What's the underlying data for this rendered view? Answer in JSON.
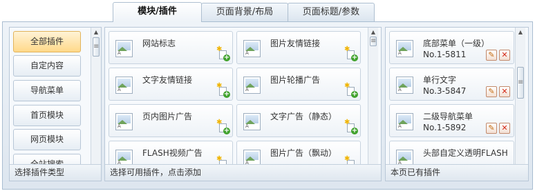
{
  "tabs": [
    {
      "label": "模块/插件",
      "active": true
    },
    {
      "label": "页面背景/布局",
      "active": false
    },
    {
      "label": "页面标题/参数",
      "active": false
    }
  ],
  "left_panel": {
    "categories": [
      {
        "label": "全部插件",
        "active": true
      },
      {
        "label": "自定内容",
        "active": false
      },
      {
        "label": "导航菜单",
        "active": false
      },
      {
        "label": "首页模块",
        "active": false
      },
      {
        "label": "网页模块",
        "active": false
      },
      {
        "label": "全站搜索",
        "active": false
      }
    ],
    "footer": "选择插件类型"
  },
  "middle_panel": {
    "plugins": [
      {
        "label": "网站标志"
      },
      {
        "label": "图片友情链接"
      },
      {
        "label": "文字友情链接"
      },
      {
        "label": "图片轮播广告"
      },
      {
        "label": "页内图片广告"
      },
      {
        "label": "文字广告（静态）"
      },
      {
        "label": "FLASH视频广告"
      },
      {
        "label": "图片广告（飘动）"
      }
    ],
    "footer": "选择可用插件，点击添加"
  },
  "right_panel": {
    "items": [
      {
        "label": "底部菜单（一级）",
        "code": "No.1-5811"
      },
      {
        "label": "单行文字",
        "code": "No.3-5847"
      },
      {
        "label": "二级导航菜单",
        "code": "No.1-5892"
      },
      {
        "label": "头部自定义透明FLASH",
        "code": ""
      }
    ],
    "footer": "本页已有插件"
  },
  "icons": {
    "thumbnail": "image-icon",
    "add": "add-plugin-icon",
    "edit": "edit-icon",
    "delete": "delete-icon"
  },
  "colors": {
    "active_category": "#ffd98a",
    "add_plus": "#41a22d",
    "delete": "#d42a17"
  }
}
